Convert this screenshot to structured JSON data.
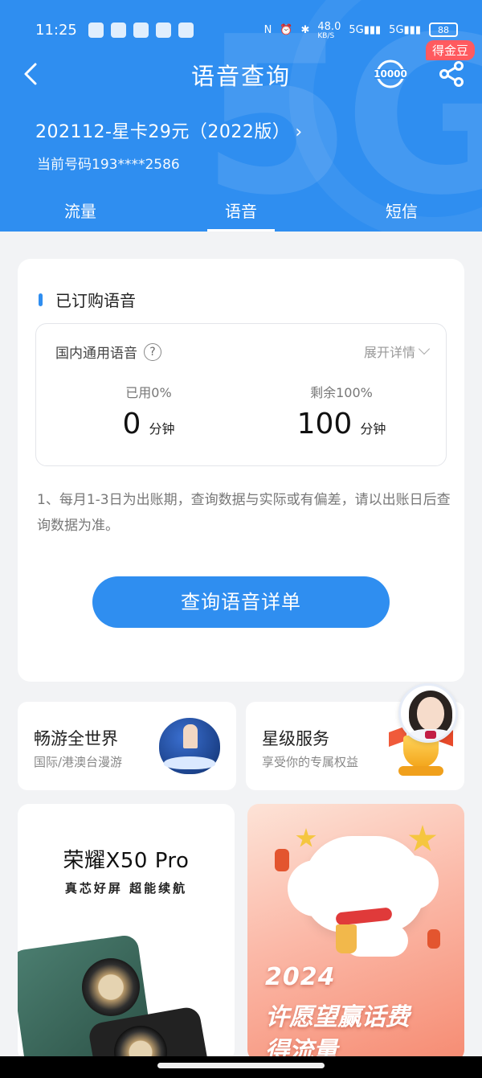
{
  "status_bar": {
    "time": "11:25",
    "network_speed": "48.0",
    "speed_unit": "KB/S",
    "signal_1": "5G",
    "signal_2": "5G",
    "battery": "88"
  },
  "nav": {
    "title": "语音查询",
    "gold_badge": "得金豆",
    "icons": [
      "back-icon",
      "hotline-10000-icon",
      "share-icon"
    ]
  },
  "plan": {
    "name": "202112-星卡29元（2022版）",
    "number_label": "当前号码193****2586"
  },
  "tabs": [
    {
      "label": "流量",
      "active": false
    },
    {
      "label": "语音",
      "active": true
    },
    {
      "label": "短信",
      "active": false
    }
  ],
  "subscribed": {
    "title": "已订购语音",
    "package_name": "国内通用语音",
    "expand_label": "展开详情",
    "used_label": "已用0%",
    "used_value": "0",
    "remaining_label": "剩余100%",
    "remaining_value": "100",
    "unit": "分钟",
    "note": "1、每月1-3日为出账期，查询数据与实际或有偏差，请以出账日后查询数据为准。",
    "query_button": "查询语音详单"
  },
  "features": [
    {
      "title": "畅游全世界",
      "subtitle": "国际/港澳台漫游"
    },
    {
      "title": "星级服务",
      "subtitle": "享受你的专属权益"
    }
  ],
  "banners": {
    "phone_title": "荣耀X50 Pro",
    "phone_subtitle": "真芯好屏 超能续航",
    "promo_year": "2024",
    "promo_line1": "许愿望赢话费",
    "promo_line2": "得流量"
  },
  "colors": {
    "primary": "#2f8ef0",
    "badge": "#ff5a5f"
  }
}
